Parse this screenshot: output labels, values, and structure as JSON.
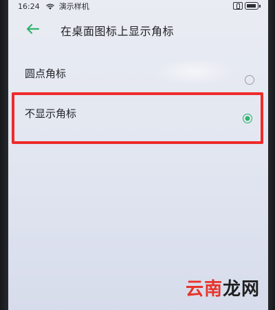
{
  "status_bar": {
    "time": "16:24",
    "carrier": "演示样机",
    "icons": [
      "wifi-icon",
      "vibrate-icon",
      "battery-icon"
    ]
  },
  "header": {
    "back_icon": "arrow-left-icon",
    "title": "在桌面图标上显示角标"
  },
  "options": [
    {
      "label": "圆点角标",
      "selected": false
    },
    {
      "label": "不显示角标",
      "selected": true
    }
  ],
  "colors": {
    "accent": "#2fb36e",
    "highlight": "#ee2b2b",
    "watermark_red": "#e8342a"
  },
  "watermark": {
    "part1": "云南",
    "part2": "龙网"
  }
}
